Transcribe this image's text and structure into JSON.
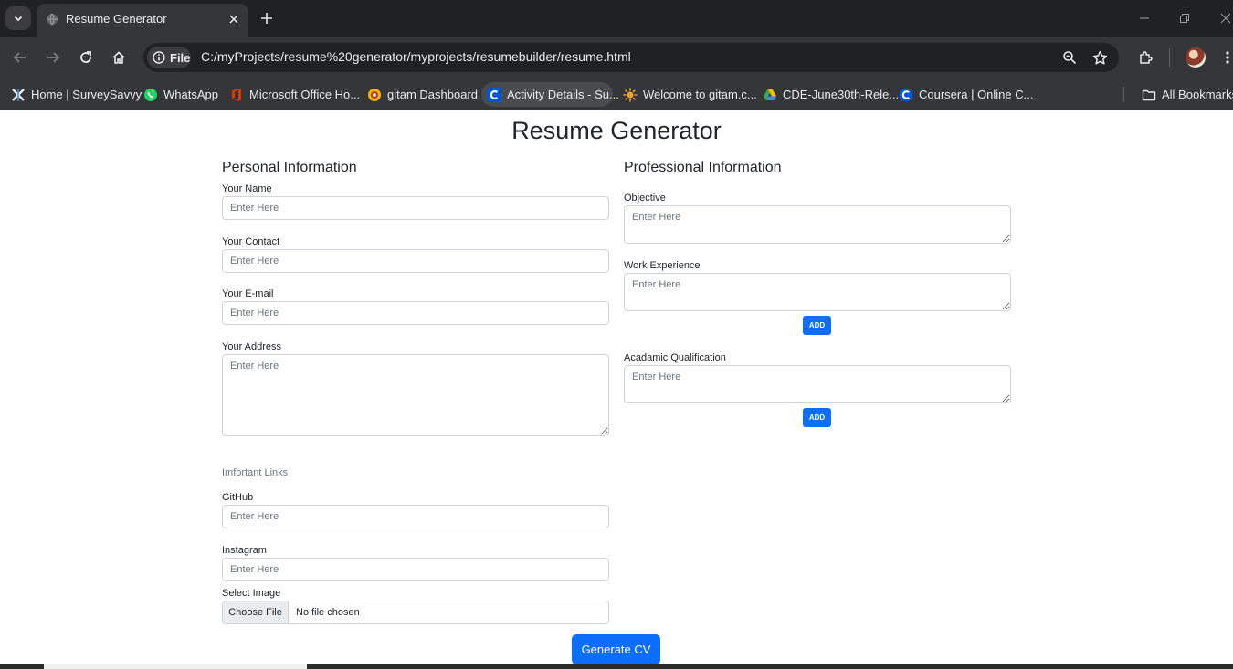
{
  "browser": {
    "tab": {
      "title": "Resume Generator",
      "favicon": "globe-icon"
    },
    "address": {
      "scheme_label": "File",
      "url": "C:/myProjects/resume%20generator/myprojects/resumebuilder/resume.html"
    },
    "bookmarks": [
      {
        "label": "Home | SurveySavvy",
        "icon": "surveysavvy-icon",
        "color": "#e8eaed"
      },
      {
        "label": "WhatsApp",
        "icon": "whatsapp-icon",
        "color": "#25d366"
      },
      {
        "label": "Microsoft Office Ho...",
        "icon": "office-icon",
        "color": "#d83b01"
      },
      {
        "label": "gitam Dashboard",
        "icon": "gitam-icon",
        "color": "#f4b400"
      },
      {
        "label": "Activity Details - Su...",
        "icon": "coursera-icon",
        "color": "#0056d2"
      },
      {
        "label": "Welcome to gitam.c...",
        "icon": "gitam-sun-icon",
        "color": "#f0a030"
      },
      {
        "label": "CDE-June30th-Rele...",
        "icon": "google-drive-icon",
        "color": "#34a853"
      },
      {
        "label": "Coursera | Online C...",
        "icon": "coursera-icon",
        "color": "#0056d2"
      }
    ],
    "all_bookmarks_label": "All Bookmarks"
  },
  "page": {
    "title": "Resume Generator",
    "personal": {
      "heading": "Personal Information",
      "name_label": "Your Name",
      "contact_label": "Your Contact",
      "email_label": "Your E-mail",
      "address_label": "Your Address",
      "placeholder": "Enter Here",
      "links_heading": "Imfortant Links",
      "github_label": "GitHub",
      "instagram_label": "Instagram",
      "image_label": "Select Image",
      "file_button": "Choose File",
      "file_status": "No file chosen"
    },
    "professional": {
      "heading": "Professional Information",
      "objective_label": "Objective",
      "work_label": "Work Experience",
      "academic_label": "Acadamic Qualification",
      "placeholder": "Enter Here",
      "add_label": "ADD"
    },
    "generate_label": "Generate CV",
    "accent_color": "#0d6efd"
  }
}
